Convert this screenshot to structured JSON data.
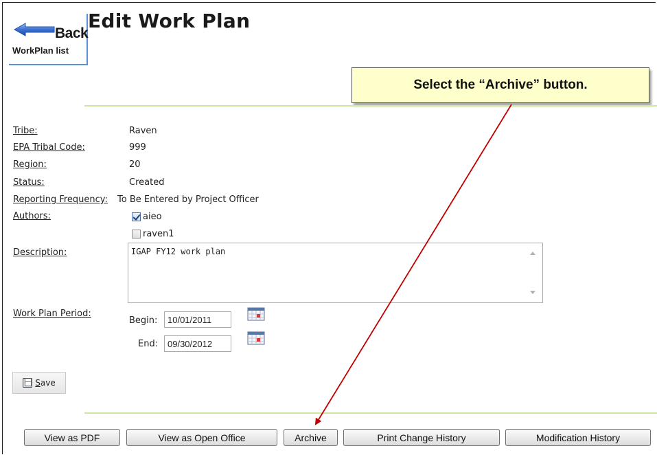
{
  "header": {
    "back_label": "Back",
    "back_sub": "WorkPlan list",
    "title": "Edit Work Plan"
  },
  "callout": {
    "text": "Select the “Archive” button."
  },
  "form": {
    "tribe_label": "Tribe:",
    "tribe_value": "Raven",
    "epa_label": "EPA Tribal Code:",
    "epa_value": "999",
    "region_label": "Region:",
    "region_value": "20",
    "status_label": "Status:",
    "status_value": "Created",
    "freq_label": "Reporting Frequency:",
    "freq_value": "To Be Entered by Project Officer",
    "authors_label": "Authors:",
    "authors": [
      {
        "name": "aieo",
        "checked": true
      },
      {
        "name": "raven1",
        "checked": false
      }
    ],
    "description_label": "Description:",
    "description_value": "IGAP FY12 work plan",
    "period_label": "Work Plan Period:",
    "begin_label": "Begin:",
    "begin_value": "10/01/2011",
    "end_label": "End:",
    "end_value": "09/30/2012",
    "save_label": "Save"
  },
  "actions": {
    "pdf": "View as PDF",
    "open_office": "View as Open Office",
    "archive": "Archive",
    "print_history": "Print Change History",
    "mod_history": "Modification History"
  },
  "colors": {
    "accent_rule": "#cde6a6",
    "callout_bg": "#ffffcc",
    "arrow": "#c00000",
    "back_arrow": "#3a6fd0"
  },
  "icons": {
    "back": "left-arrow-icon",
    "calendar": "calendar-icon",
    "save": "floppy-disk-icon"
  }
}
